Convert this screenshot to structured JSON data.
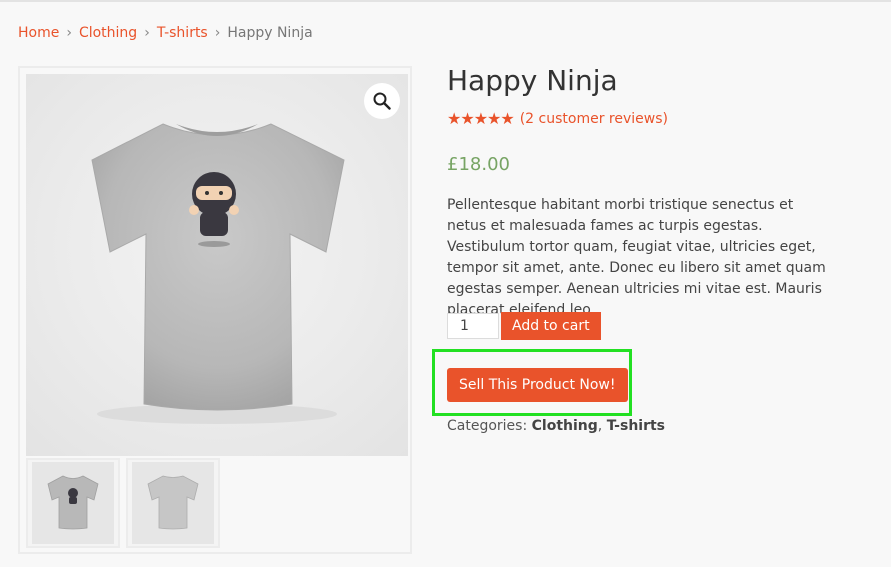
{
  "breadcrumb": {
    "items": [
      "Home",
      "Clothing",
      "T-shirts"
    ],
    "current": "Happy Ninja"
  },
  "gallery": {
    "zoom_icon": "magnifier-icon",
    "thumbnails": [
      "ninja-shirt-front",
      "shirt-back"
    ]
  },
  "product": {
    "title": "Happy Ninja",
    "rating": 5,
    "rating_max": 5,
    "reviews_label": "(2 customer reviews)",
    "reviews_text": "2 customer reviews",
    "price": "£18.00",
    "description": "Pellentesque habitant morbi tristique senectus et netus et malesuada fames ac turpis egestas. Vestibulum tortor quam, feugiat vitae, ultricies eget, tempor sit amet, ante. Donec eu libero sit amet quam egestas semper. Aenean ultricies mi vitae est. Mauris placerat eleifend leo."
  },
  "cart": {
    "quantity": "1",
    "add_label": "Add to cart"
  },
  "sell": {
    "label": "Sell This Product Now!"
  },
  "categories": {
    "label": "Categories:",
    "items": [
      "Clothing",
      "T-shirts"
    ],
    "separator": ","
  },
  "colors": {
    "accent": "#e9532b",
    "price": "#77a464",
    "highlight": "#22e022"
  }
}
